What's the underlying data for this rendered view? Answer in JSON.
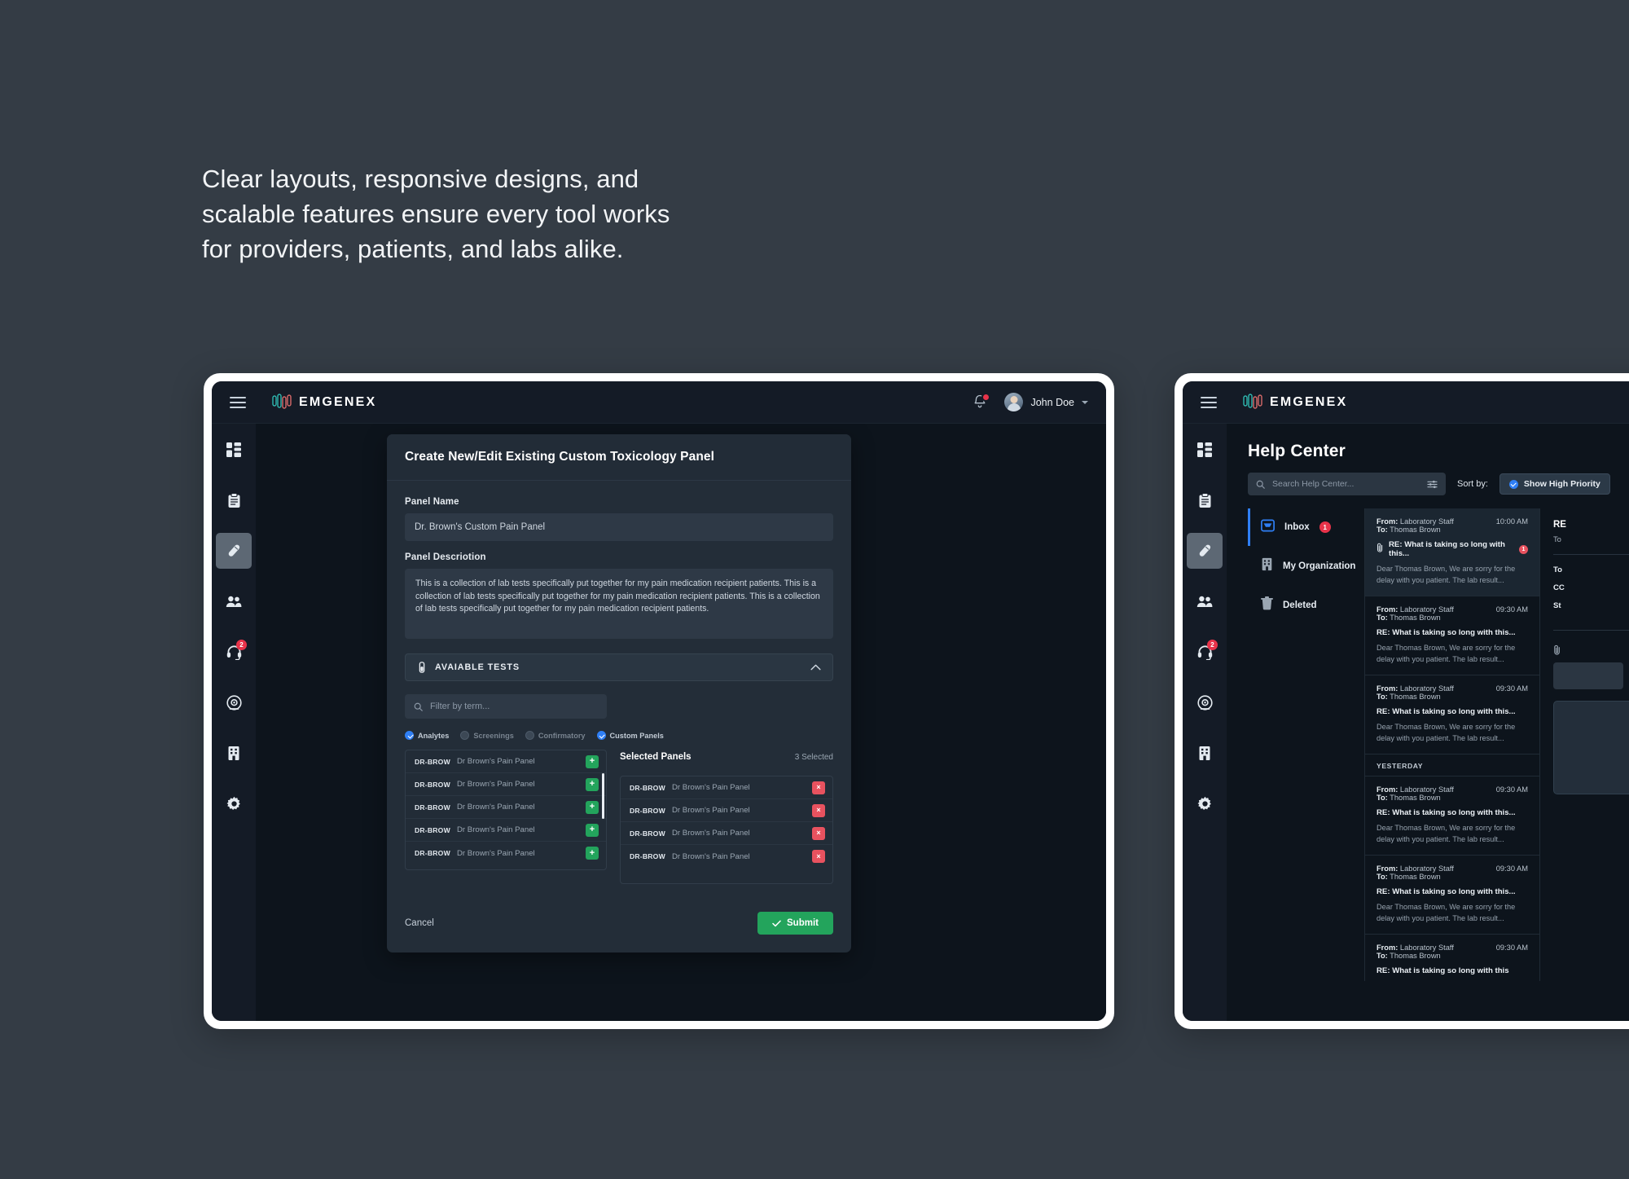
{
  "headline": "Clear layouts, responsive designs, and scalable features ensure every tool works for providers, patients, and labs alike.",
  "colors": {
    "page_background": "#343c45",
    "app_background": "#0d141c",
    "panel": "#232d38",
    "accent_blue": "#2f7ff5",
    "accent_green": "#23a45c",
    "accent_red": "#e8525f",
    "badge_red": "#e8334a",
    "accent_orange": "#e8883c"
  },
  "topbar": {
    "menu_icon": "hamburger-icon",
    "brand": "EMGENEX",
    "notification_icon": "bell-icon",
    "notification_badge": "",
    "user_name": "John Doe",
    "caret_icon": "chevron-down-icon"
  },
  "sidebar": {
    "items": [
      {
        "icon": "dashboard-grid-icon",
        "name": "dashboard",
        "active": false,
        "badge": ""
      },
      {
        "icon": "clipboard-icon",
        "name": "orders",
        "active": false,
        "badge": ""
      },
      {
        "icon": "test-tube-icon",
        "name": "lab-tests",
        "active": true,
        "badge": ""
      },
      {
        "icon": "users-icon",
        "name": "patients",
        "active": false,
        "badge": ""
      },
      {
        "icon": "headset-icon",
        "name": "support",
        "active": false,
        "badge": "2"
      },
      {
        "icon": "microscope-icon",
        "name": "laboratory",
        "active": false,
        "badge": ""
      },
      {
        "icon": "building-icon",
        "name": "organization",
        "active": false,
        "badge": ""
      },
      {
        "icon": "gear-icon",
        "name": "settings",
        "active": false,
        "badge": ""
      }
    ]
  },
  "modal": {
    "title": "Create New/Edit Existing Custom Toxicology Panel",
    "panel_name_label": "Panel Name",
    "panel_name_value": "Dr. Brown's Custom Pain Panel",
    "panel_name_placeholder": "Panel Name",
    "panel_description_label": "Panel Descriotion",
    "panel_description_value": "This is a collection of lab tests specifically put together for my pain medication recipient patients. This is a collection of lab tests specifically put together for my pain medication recipient patients. This is a collection of lab tests specifically put together for my pain medication recipient patients.",
    "accordion_label": "AVAIABLE TESTS",
    "accordion_icon": "test-tube-icon",
    "accordion_chevron": "chevron-up-icon",
    "filter_placeholder": "Filter by term...",
    "filter_icon": "search-icon",
    "checkboxes": [
      {
        "label": "Analytes",
        "checked": true
      },
      {
        "label": "Screenings",
        "checked": false
      },
      {
        "label": "Confirmatory",
        "checked": false
      },
      {
        "label": "Custom Panels",
        "checked": true
      }
    ],
    "selected_title": "Selected Panels",
    "selected_count": "3 Selected",
    "available_rows": [
      {
        "code": "DR-BROW",
        "name": "Dr Brown's Pain Panel",
        "action": "+"
      },
      {
        "code": "DR-BROW",
        "name": "Dr Brown's Pain Panel",
        "action": "+"
      },
      {
        "code": "DR-BROW",
        "name": "Dr Brown's Pain Panel",
        "action": "+"
      },
      {
        "code": "DR-BROW",
        "name": "Dr Brown's Pain Panel",
        "action": "+"
      },
      {
        "code": "DR-BROW",
        "name": "Dr Brown's Pain Panel",
        "action": "+"
      }
    ],
    "selected_rows": [
      {
        "code": "DR-BROW",
        "name": "Dr Brown's Pain Panel",
        "action": "×"
      },
      {
        "code": "DR-BROW",
        "name": "Dr Brown's Pain Panel",
        "action": "×"
      },
      {
        "code": "DR-BROW",
        "name": "Dr Brown's Pain Panel",
        "action": "×"
      },
      {
        "code": "DR-BROW",
        "name": "Dr Brown's Pain Panel",
        "action": "×"
      }
    ],
    "cancel_label": "Cancel",
    "submit_label": "Submit",
    "submit_icon": "check-icon"
  },
  "help_center": {
    "title": "Help Center",
    "search_placeholder": "Search Help Center...",
    "search_icon": "search-icon",
    "filter_icon": "sliders-icon",
    "sort_label": "Sort by:",
    "sort_chip": "Show High Priority",
    "folders": [
      {
        "label": "Inbox",
        "icon": "inbox-icon",
        "badge": "1",
        "active": true
      },
      {
        "label": "My Organization",
        "icon": "building-icon",
        "badge": "",
        "active": false
      },
      {
        "label": "Deleted",
        "icon": "trash-icon",
        "badge": "",
        "active": false
      }
    ],
    "mails": [
      {
        "from_label": "From:",
        "from": "Laboratory Staff",
        "to_label": "To:",
        "to": "Thomas Brown",
        "time": "10:00 AM",
        "subject": "RE: What is taking so long with this...",
        "preview": "Dear Thomas Brown, We are sorry for the delay with you patient. The lab result...",
        "attachment": true,
        "unread": "1",
        "selected": true
      },
      {
        "from_label": "From:",
        "from": "Laboratory Staff",
        "to_label": "To:",
        "to": "Thomas Brown",
        "time": "09:30 AM",
        "subject": "RE: What is taking so long with this...",
        "preview": "Dear Thomas Brown, We are sorry for the delay with you patient. The lab result...",
        "attachment": false,
        "unread": "",
        "selected": false
      },
      {
        "from_label": "From:",
        "from": "Laboratory Staff",
        "to_label": "To:",
        "to": "Thomas Brown",
        "time": "09:30 AM",
        "subject": "RE: What is taking so long with this...",
        "preview": "Dear Thomas Brown, We are sorry for the delay with you patient. The lab result...",
        "attachment": false,
        "unread": "",
        "selected": false
      }
    ],
    "day_separator": "YESTERDAY",
    "mails_yesterday": [
      {
        "from_label": "From:",
        "from": "Laboratory Staff",
        "to_label": "To:",
        "to": "Thomas Brown",
        "time": "09:30 AM",
        "subject": "RE: What is taking so long with this...",
        "preview": "Dear Thomas Brown, We are sorry for the delay with you patient. The lab result...",
        "attachment": false,
        "unread": "",
        "selected": false
      },
      {
        "from_label": "From:",
        "from": "Laboratory Staff",
        "to_label": "To:",
        "to": "Thomas Brown",
        "time": "09:30 AM",
        "subject": "RE: What is taking so long with this...",
        "preview": "Dear Thomas Brown, We are sorry for the delay with you patient. The lab result...",
        "attachment": false,
        "unread": "",
        "selected": false
      },
      {
        "from_label": "From:",
        "from": "Laboratory Staff",
        "to_label": "To:",
        "to": "Thomas Brown",
        "time": "09:30 AM",
        "subject": "RE: What is taking so long with this",
        "preview": "",
        "attachment": false,
        "unread": "",
        "selected": false
      }
    ],
    "reader": {
      "subject": "RE",
      "to_line": "To",
      "kv1": "To",
      "kv2": "CC",
      "kv3": "St",
      "attachment_icon": "paperclip-icon"
    }
  }
}
